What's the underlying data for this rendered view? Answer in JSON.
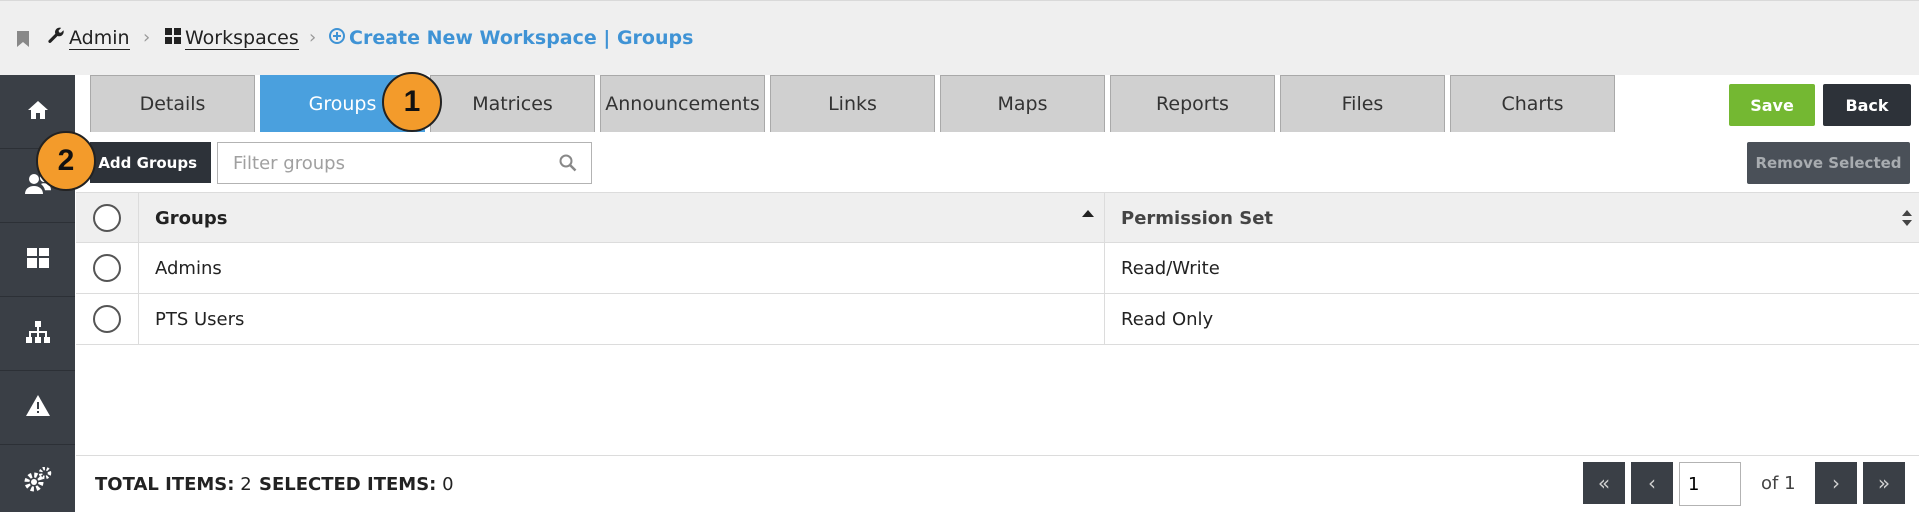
{
  "breadcrumb": {
    "admin": "Admin",
    "workspaces": "Workspaces",
    "current": "Create New Workspace | Groups"
  },
  "sidebar": {
    "items": [
      "home-icon",
      "users-icon",
      "dashboard-icon",
      "hierarchy-icon",
      "warning-icon",
      "settings-icon"
    ]
  },
  "tabs": [
    {
      "label": "Details"
    },
    {
      "label": "Groups"
    },
    {
      "label": "Matrices"
    },
    {
      "label": "Announcements"
    },
    {
      "label": "Links"
    },
    {
      "label": "Maps"
    },
    {
      "label": "Reports"
    },
    {
      "label": "Files"
    },
    {
      "label": "Charts"
    }
  ],
  "active_tab": "Groups",
  "actions": {
    "save": "Save",
    "back": "Back"
  },
  "toolbar": {
    "add_groups": "Add Groups",
    "filter_placeholder": "Filter groups",
    "remove_selected": "Remove Selected"
  },
  "table": {
    "columns": [
      "Groups",
      "Permission Set"
    ],
    "rows": [
      {
        "group": "Admins",
        "permission": "Read/Write"
      },
      {
        "group": "PTS Users",
        "permission": "Read Only"
      }
    ]
  },
  "footer": {
    "total_label": "TOTAL ITEMS:",
    "total_value": "2",
    "selected_label": "SELECTED ITEMS:",
    "selected_value": "0",
    "page": "1",
    "of_pages": "of 1"
  },
  "callouts": [
    "1",
    "2"
  ],
  "colors": {
    "accent_blue": "#4aa0de",
    "save_green": "#74b832",
    "dark": "#2d3239",
    "callout_orange": "#f39b2b"
  }
}
